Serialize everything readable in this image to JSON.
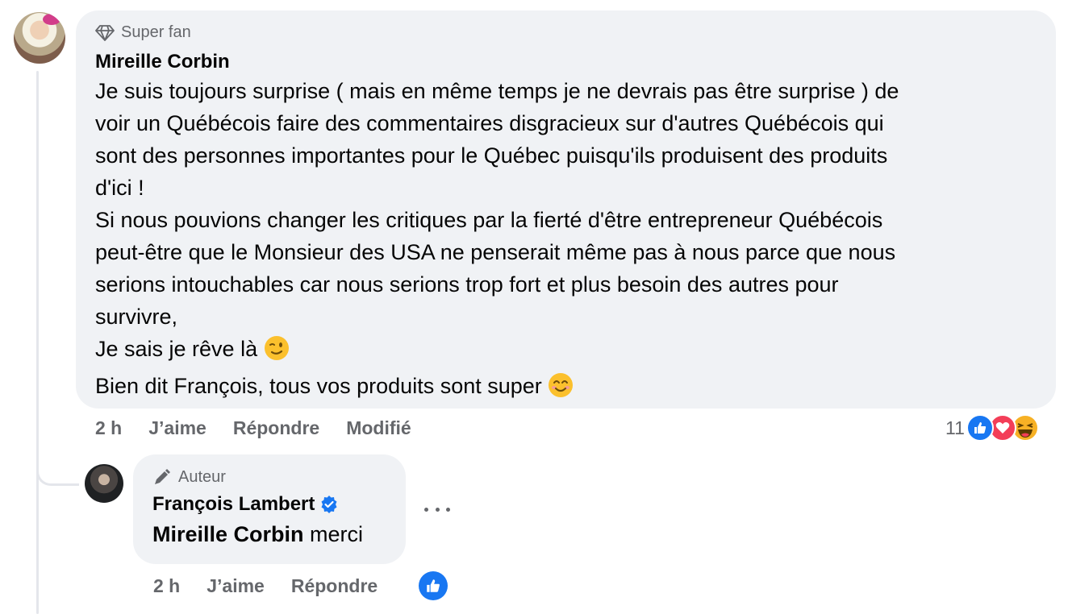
{
  "comment": {
    "badge": "Super fan",
    "author": "Mireille Corbin",
    "lines": [
      "Je suis toujours surprise ( mais en même temps je ne devrais pas être surprise ) de",
      "voir un Québécois faire des commentaires disgracieux sur d'autres Québécois qui",
      "sont des personnes importantes pour le Québec puisqu'ils produisent des produits",
      "d'ici !",
      "Si nous pouvions changer les critiques par la fierté d'être entrepreneur Québécois",
      "peut-être que le Monsieur des USA ne penserait même pas à nous parce que nous",
      "serions intouchables car nous serions trop fort et plus besoin des autres pour",
      "survivre,",
      "Je sais je rêve là",
      "Bien dit François, tous vos produits sont super"
    ],
    "emoji_wink": "wink-emoji",
    "emoji_smile": "smile-emoji",
    "actions": {
      "time": "2 h",
      "like": "J’aime",
      "reply": "Répondre",
      "edited": "Modifié"
    },
    "reactions": {
      "count": "11",
      "types": [
        "like",
        "love",
        "haha"
      ]
    }
  },
  "reply": {
    "badge": "Auteur",
    "author": "François Lambert",
    "mention": "Mireille Corbin",
    "text": "merci",
    "actions": {
      "time": "2 h",
      "like": "J’aime",
      "reply": "Répondre"
    }
  },
  "colors": {
    "bubble": "#f0f2f5",
    "secondary_text": "#65676b",
    "like_blue": "#1877f2",
    "love_red": "#f33e58",
    "haha_yellow": "#f7b125"
  }
}
